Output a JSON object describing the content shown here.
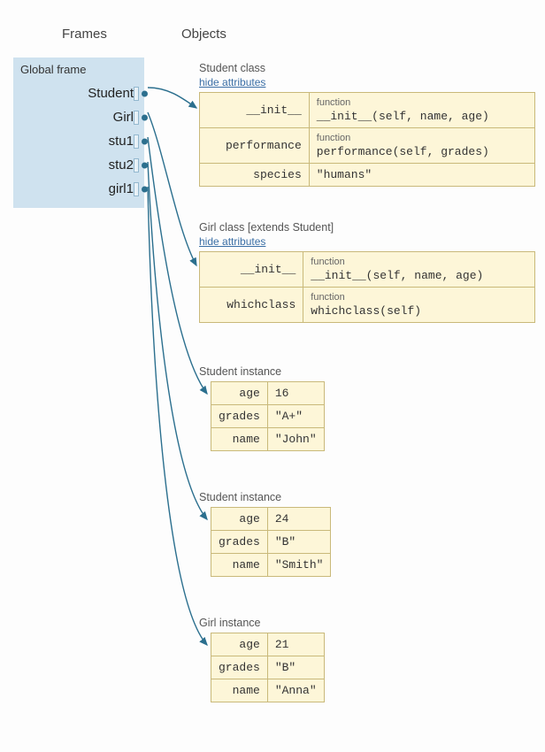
{
  "headers": {
    "frames": "Frames",
    "objects": "Objects"
  },
  "globalFrame": {
    "title": "Global frame",
    "vars": {
      "student": "Student",
      "girl": "Girl",
      "stu1": "stu1",
      "stu2": "stu2",
      "girl1": "girl1"
    }
  },
  "hideAttributes": "hide attributes",
  "studentClass": {
    "label": "Student class",
    "init": {
      "key": "__init__",
      "fn": "function",
      "sig": "__init__(self, name, age)"
    },
    "performance": {
      "key": "performance",
      "fn": "function",
      "sig": "performance(self, grades)"
    },
    "species": {
      "key": "species",
      "val": "\"humans\""
    }
  },
  "girlClass": {
    "label": "Girl class [extends Student]",
    "init": {
      "key": "__init__",
      "fn": "function",
      "sig": "__init__(self, name, age)"
    },
    "whichclass": {
      "key": "whichclass",
      "fn": "function",
      "sig": "whichclass(self)"
    }
  },
  "inst1": {
    "label": "Student instance",
    "age": {
      "key": "age",
      "val": "16"
    },
    "grades": {
      "key": "grades",
      "val": "\"A+\""
    },
    "name": {
      "key": "name",
      "val": "\"John\""
    }
  },
  "inst2": {
    "label": "Student instance",
    "age": {
      "key": "age",
      "val": "24"
    },
    "grades": {
      "key": "grades",
      "val": "\"B\""
    },
    "name": {
      "key": "name",
      "val": "\"Smith\""
    }
  },
  "inst3": {
    "label": "Girl instance",
    "age": {
      "key": "age",
      "val": "21"
    },
    "grades": {
      "key": "grades",
      "val": "\"B\""
    },
    "name": {
      "key": "name",
      "val": "\"Anna\""
    }
  }
}
